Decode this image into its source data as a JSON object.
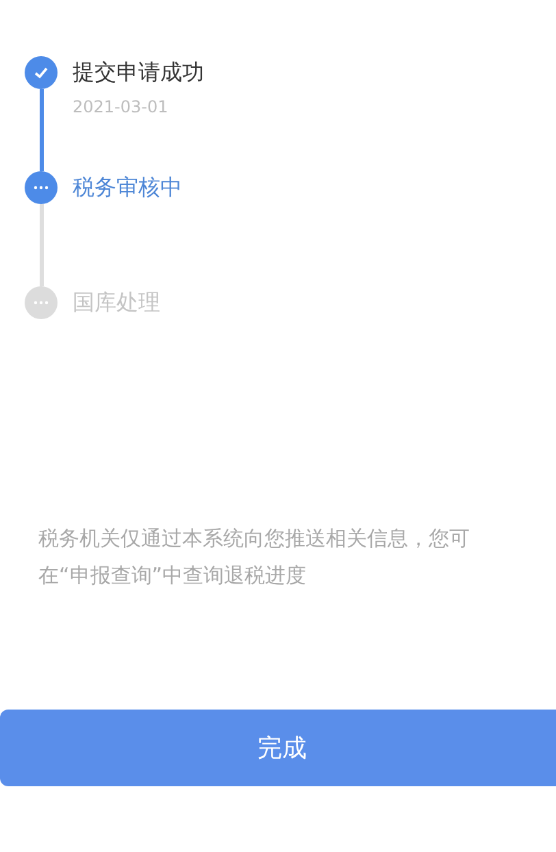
{
  "steps": [
    {
      "title": "提交申请成功",
      "date": "2021-03-01",
      "kind": "done"
    },
    {
      "title": "税务审核中",
      "kind": "active"
    },
    {
      "title": "国库处理",
      "kind": "pending"
    }
  ],
  "note": "税务机关仅通过本系统向您推送相关信息，您可在“申报查询”中查询退税进度",
  "button": {
    "label": "完成"
  }
}
